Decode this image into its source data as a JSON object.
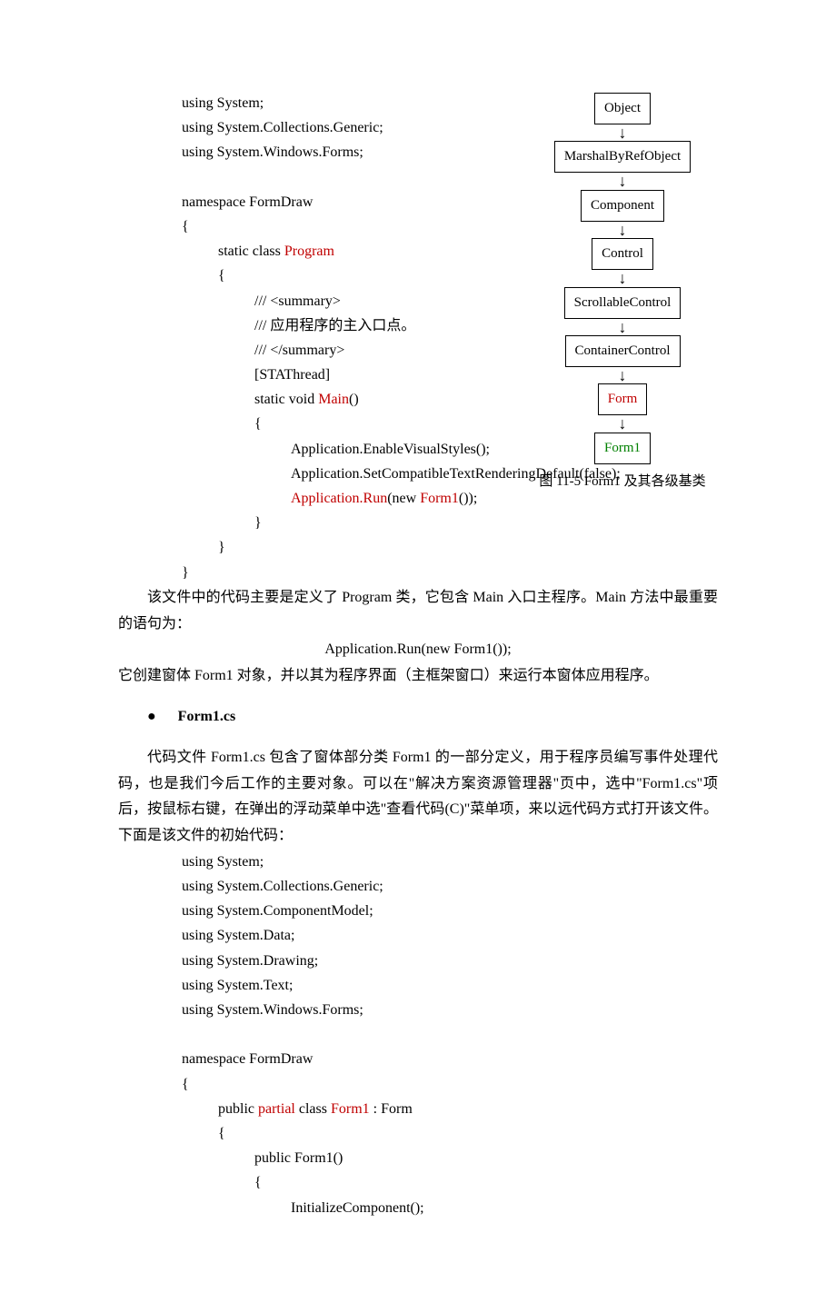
{
  "code1": {
    "l1": "using System;",
    "l2": "using System.Collections.Generic;",
    "l3": "using System.Windows.Forms;",
    "l4": "namespace FormDraw",
    "l5": "{",
    "l6a": "static class ",
    "l6b": "Program",
    "l7": "{",
    "l8": "/// <summary>",
    "l9": "///  应用程序的主入口点。",
    "l10": "/// </summary>",
    "l11": "[STAThread]",
    "l12a": "static void ",
    "l12b": "Main",
    "l12c": "()",
    "l13": "{",
    "l14": "Application.EnableVisualStyles();",
    "l15": "Application.SetCompatibleTextRenderingDefault(false);",
    "l16a": "Application.Run",
    "l16b": "(new ",
    "l16c": "Form1",
    "l16d": "());",
    "l17": "}",
    "l18": "}",
    "l19": "}"
  },
  "diagram": {
    "n1": "Object",
    "n2": "MarshalByRefObject",
    "n3": "Component",
    "n4": "Control",
    "n5": "ScrollableControl",
    "n6": "ContainerControl",
    "n7": "Form",
    "n8": "Form1",
    "caption": "图 11-5 Form1 及其各级基类"
  },
  "text": {
    "p1": "该文件中的代码主要是定义了 Program 类，它包含 Main 入口主程序。Main 方法中最重要的语句为：",
    "p2": "Application.Run(new Form1());",
    "p3": "它创建窗体 Form1 对象，并以其为程序界面（主框架窗口）来运行本窗体应用程序。",
    "bullet1": "Form1.cs",
    "p4": "代码文件 Form1.cs 包含了窗体部分类 Form1 的一部分定义，用于程序员编写事件处理代码，也是我们今后工作的主要对象。可以在\"解决方案资源管理器\"页中，选中\"Form1.cs\"项后，按鼠标右键，在弹出的浮动菜单中选\"查看代码(C)\"菜单项，来以远代码方式打开该文件。下面是该文件的初始代码："
  },
  "code2": {
    "l1": "using System;",
    "l2": "using System.Collections.Generic;",
    "l3": "using System.ComponentModel;",
    "l4": "using System.Data;",
    "l5": "using System.Drawing;",
    "l6": "using System.Text;",
    "l7": "using System.Windows.Forms;",
    "l8": "namespace FormDraw",
    "l9": "{",
    "l10a": "public ",
    "l10b": "partial",
    "l10c": " class ",
    "l10d": "Form1",
    "l10e": " : Form",
    "l11": "{",
    "l12": "public Form1()",
    "l13": "{",
    "l14": "InitializeComponent();"
  }
}
